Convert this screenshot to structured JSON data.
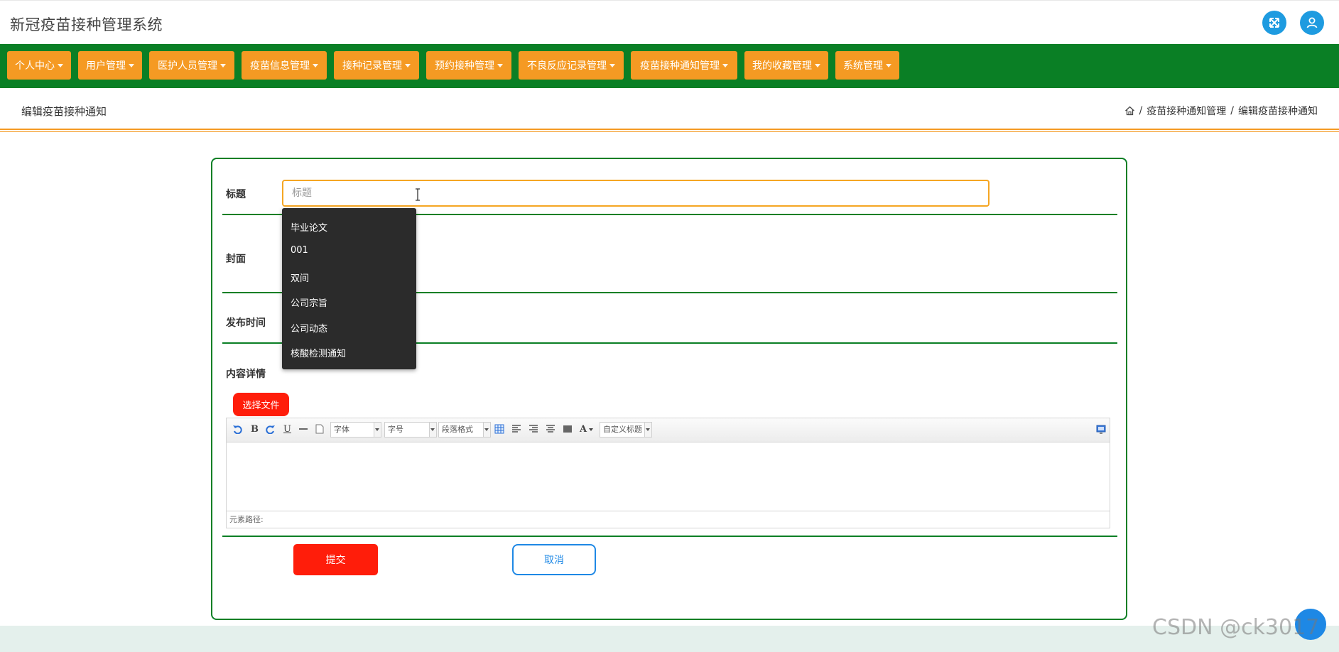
{
  "app": {
    "title": "新冠疫苗接种管理系统"
  },
  "header": {
    "fullscreen_icon": "expand-arrows-icon",
    "user_icon": "user-icon"
  },
  "nav": {
    "items": [
      {
        "label": "个人中心"
      },
      {
        "label": "用户管理"
      },
      {
        "label": "医护人员管理"
      },
      {
        "label": "疫苗信息管理"
      },
      {
        "label": "接种记录管理"
      },
      {
        "label": "预约接种管理"
      },
      {
        "label": "不良反应记录管理"
      },
      {
        "label": "疫苗接种通知管理"
      },
      {
        "label": "我的收藏管理"
      },
      {
        "label": "系统管理"
      }
    ]
  },
  "page": {
    "title": "编辑疫苗接种通知"
  },
  "breadcrumb": {
    "home_icon": "home-icon",
    "sep": "/",
    "level1": "疫苗接种通知管理",
    "level2": "编辑疫苗接种通知"
  },
  "form": {
    "title_label": "标题",
    "title_placeholder": "标题",
    "title_value": "",
    "cover_label": "封面",
    "publish_time_label": "发布时间",
    "content_label": "内容详情",
    "choose_file": "选择文件",
    "submit": "提交",
    "cancel": "取消"
  },
  "autocomplete": {
    "items": [
      "毕业论文",
      "001",
      "双间",
      "公司宗旨",
      "公司动态",
      "核酸检测通知"
    ]
  },
  "editor": {
    "font_select": "字体",
    "size_select": "字号",
    "paragraph_select": "段落格式",
    "custom_title_select": "自定义标题",
    "bold": "B",
    "underline": "U",
    "font_color": "A",
    "status_path": "元素路径:"
  },
  "watermark": "CSDN @ck3017",
  "colors": {
    "nav_bg": "#0a7f25",
    "nav_item": "#f59a23",
    "accent_blue": "#1e9be0",
    "danger": "#ff1d0a"
  }
}
